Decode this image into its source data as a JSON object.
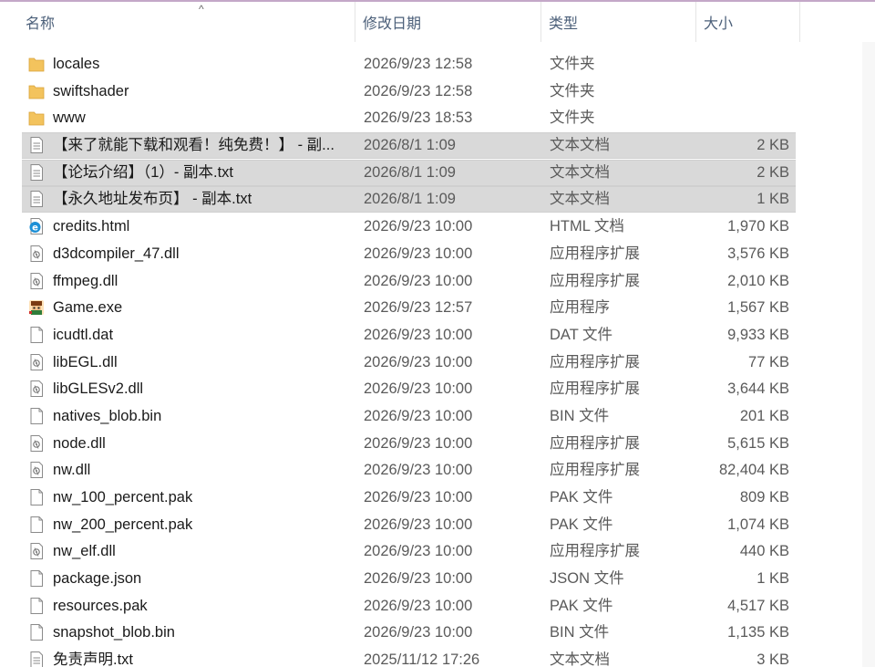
{
  "columns": {
    "name": "名称",
    "date": "修改日期",
    "type": "类型",
    "size": "大小"
  },
  "colors": {
    "folder": "#f3c35d",
    "selected_row": "#d9d9d9",
    "header_text": "#4c607a"
  },
  "files": [
    {
      "name": "locales",
      "date": "2026/9/23 12:58",
      "type": "文件夹",
      "size": "",
      "icon": "folder-icon",
      "selected": false
    },
    {
      "name": "swiftshader",
      "date": "2026/9/23 12:58",
      "type": "文件夹",
      "size": "",
      "icon": "folder-icon",
      "selected": false
    },
    {
      "name": "www",
      "date": "2026/9/23 18:53",
      "type": "文件夹",
      "size": "",
      "icon": "folder-icon",
      "selected": false
    },
    {
      "name": "【来了就能下载和观看！纯免费！】 - 副...",
      "date": "2026/8/1 1:09",
      "type": "文本文档",
      "size": "2 KB",
      "icon": "text-file-icon",
      "selected": true
    },
    {
      "name": "【论坛介绍】（1）- 副本.txt",
      "date": "2026/8/1 1:09",
      "type": "文本文档",
      "size": "2 KB",
      "icon": "text-file-icon",
      "selected": true
    },
    {
      "name": "【永久地址发布页】 - 副本.txt",
      "date": "2026/8/1 1:09",
      "type": "文本文档",
      "size": "1 KB",
      "icon": "text-file-icon",
      "selected": true
    },
    {
      "name": "credits.html",
      "date": "2026/9/23 10:00",
      "type": "HTML 文档",
      "size": "1,970 KB",
      "icon": "html-file-icon",
      "selected": false
    },
    {
      "name": "d3dcompiler_47.dll",
      "date": "2026/9/23 10:00",
      "type": "应用程序扩展",
      "size": "3,576 KB",
      "icon": "dll-file-icon",
      "selected": false
    },
    {
      "name": "ffmpeg.dll",
      "date": "2026/9/23 10:00",
      "type": "应用程序扩展",
      "size": "2,010 KB",
      "icon": "dll-file-icon",
      "selected": false
    },
    {
      "name": "Game.exe",
      "date": "2026/9/23 12:57",
      "type": "应用程序",
      "size": "1,567 KB",
      "icon": "game-exe-icon",
      "selected": false
    },
    {
      "name": "icudtl.dat",
      "date": "2026/9/23 10:00",
      "type": "DAT 文件",
      "size": "9,933 KB",
      "icon": "blank-file-icon",
      "selected": false
    },
    {
      "name": "libEGL.dll",
      "date": "2026/9/23 10:00",
      "type": "应用程序扩展",
      "size": "77 KB",
      "icon": "dll-file-icon",
      "selected": false
    },
    {
      "name": "libGLESv2.dll",
      "date": "2026/9/23 10:00",
      "type": "应用程序扩展",
      "size": "3,644 KB",
      "icon": "dll-file-icon",
      "selected": false
    },
    {
      "name": "natives_blob.bin",
      "date": "2026/9/23 10:00",
      "type": "BIN 文件",
      "size": "201 KB",
      "icon": "blank-file-icon",
      "selected": false
    },
    {
      "name": "node.dll",
      "date": "2026/9/23 10:00",
      "type": "应用程序扩展",
      "size": "5,615 KB",
      "icon": "dll-file-icon",
      "selected": false
    },
    {
      "name": "nw.dll",
      "date": "2026/9/23 10:00",
      "type": "应用程序扩展",
      "size": "82,404 KB",
      "icon": "dll-file-icon",
      "selected": false
    },
    {
      "name": "nw_100_percent.pak",
      "date": "2026/9/23 10:00",
      "type": "PAK 文件",
      "size": "809 KB",
      "icon": "blank-file-icon",
      "selected": false
    },
    {
      "name": "nw_200_percent.pak",
      "date": "2026/9/23 10:00",
      "type": "PAK 文件",
      "size": "1,074 KB",
      "icon": "blank-file-icon",
      "selected": false
    },
    {
      "name": "nw_elf.dll",
      "date": "2026/9/23 10:00",
      "type": "应用程序扩展",
      "size": "440 KB",
      "icon": "dll-file-icon",
      "selected": false
    },
    {
      "name": "package.json",
      "date": "2026/9/23 10:00",
      "type": "JSON 文件",
      "size": "1 KB",
      "icon": "blank-file-icon",
      "selected": false
    },
    {
      "name": "resources.pak",
      "date": "2026/9/23 10:00",
      "type": "PAK 文件",
      "size": "4,517 KB",
      "icon": "blank-file-icon",
      "selected": false
    },
    {
      "name": "snapshot_blob.bin",
      "date": "2026/9/23 10:00",
      "type": "BIN 文件",
      "size": "1,135 KB",
      "icon": "blank-file-icon",
      "selected": false
    },
    {
      "name": "免责声明.txt",
      "date": "2025/11/12 17:26",
      "type": "文本文档",
      "size": "3 KB",
      "icon": "text-file-icon",
      "selected": false
    }
  ]
}
